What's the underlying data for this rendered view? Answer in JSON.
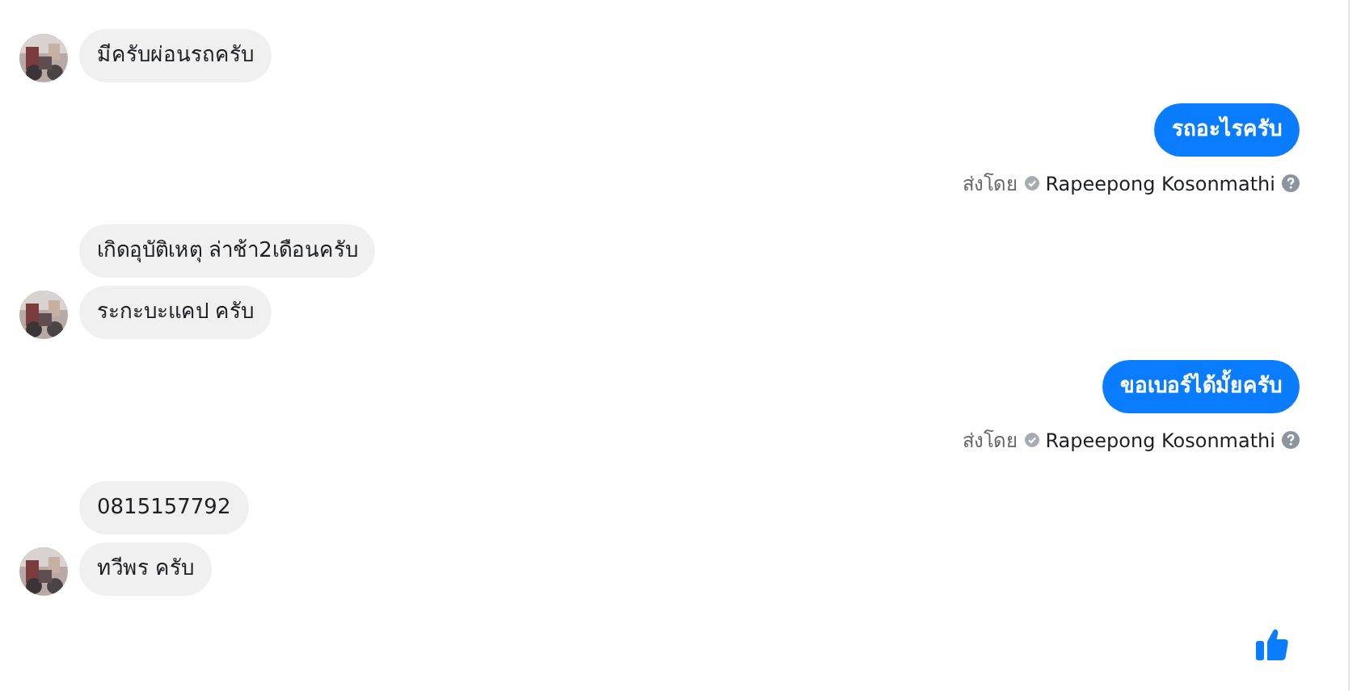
{
  "messages": [
    {
      "kind": "incoming",
      "texts": [
        "มีครับผ่อนรถครับ"
      ]
    },
    {
      "kind": "outgoing",
      "text": "รถอะไรครับ",
      "sent_by_label": "ส่งโดย",
      "sender": "Rapeepong Kosonmathi"
    },
    {
      "kind": "incoming",
      "texts": [
        "เกิดอุบัติเหตุ ล่าช้า2เดือนครับ",
        "ระกะบะแคป ครับ"
      ]
    },
    {
      "kind": "outgoing",
      "text": "ขอเบอร์ได้มั้ยครับ",
      "sent_by_label": "ส่งโดย",
      "sender": "Rapeepong Kosonmathi"
    },
    {
      "kind": "incoming",
      "texts": [
        "0815157792",
        "ทวีพร ครับ"
      ]
    },
    {
      "kind": "like"
    }
  ]
}
